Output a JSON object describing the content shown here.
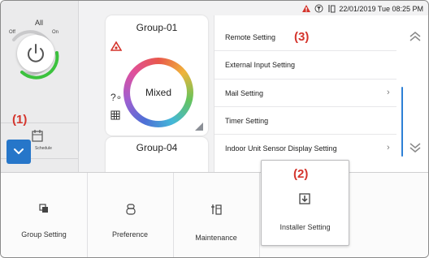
{
  "all_control": {
    "label": "All",
    "off_label": "Off",
    "on_label": "On",
    "power_icon": "power-icon",
    "schedule_label": "Schedule",
    "expand_icon": "chevron-down-icon"
  },
  "status_bar": {
    "icons": [
      "alarm-warning-icon",
      "filter-icon",
      "maintenance-icon"
    ],
    "datetime": "22/01/2019 Tue 08:25 PM"
  },
  "groups": [
    {
      "name": "Group-01",
      "mode": "Mixed",
      "badges": [
        "error-warning-icon",
        "unknown-sensor-icon",
        "schedule-grid-icon"
      ]
    },
    {
      "name": "Group-04"
    }
  ],
  "menu": {
    "items": [
      {
        "label": "Remote Setting"
      },
      {
        "label": "External Input Setting"
      },
      {
        "label": "Mail Setting",
        "chevron": true
      },
      {
        "label": "Timer Setting"
      },
      {
        "label": "Indoor Unit Sensor Display Setting",
        "chevron": true
      }
    ],
    "scroll_up_icon": "double-chevron-up-icon",
    "scroll_down_icon": "double-chevron-down-icon"
  },
  "callouts": {
    "one": "(1)",
    "two": "(2)",
    "three": "(3)"
  },
  "bottom_tabs": [
    {
      "label": "Group Setting",
      "icon": "group-setting-icon"
    },
    {
      "label": "Preference",
      "icon": "preference-icon"
    },
    {
      "label": "Maintenance",
      "icon": "maintenance-tools-icon"
    },
    {
      "label": "Installer Setting",
      "icon": "download-box-icon",
      "active": true
    }
  ],
  "colors": {
    "accent_blue": "#2676c9",
    "power_ring_green": "#3cc23e",
    "warning_red": "#d4342c",
    "callout_red": "#d4342c"
  }
}
